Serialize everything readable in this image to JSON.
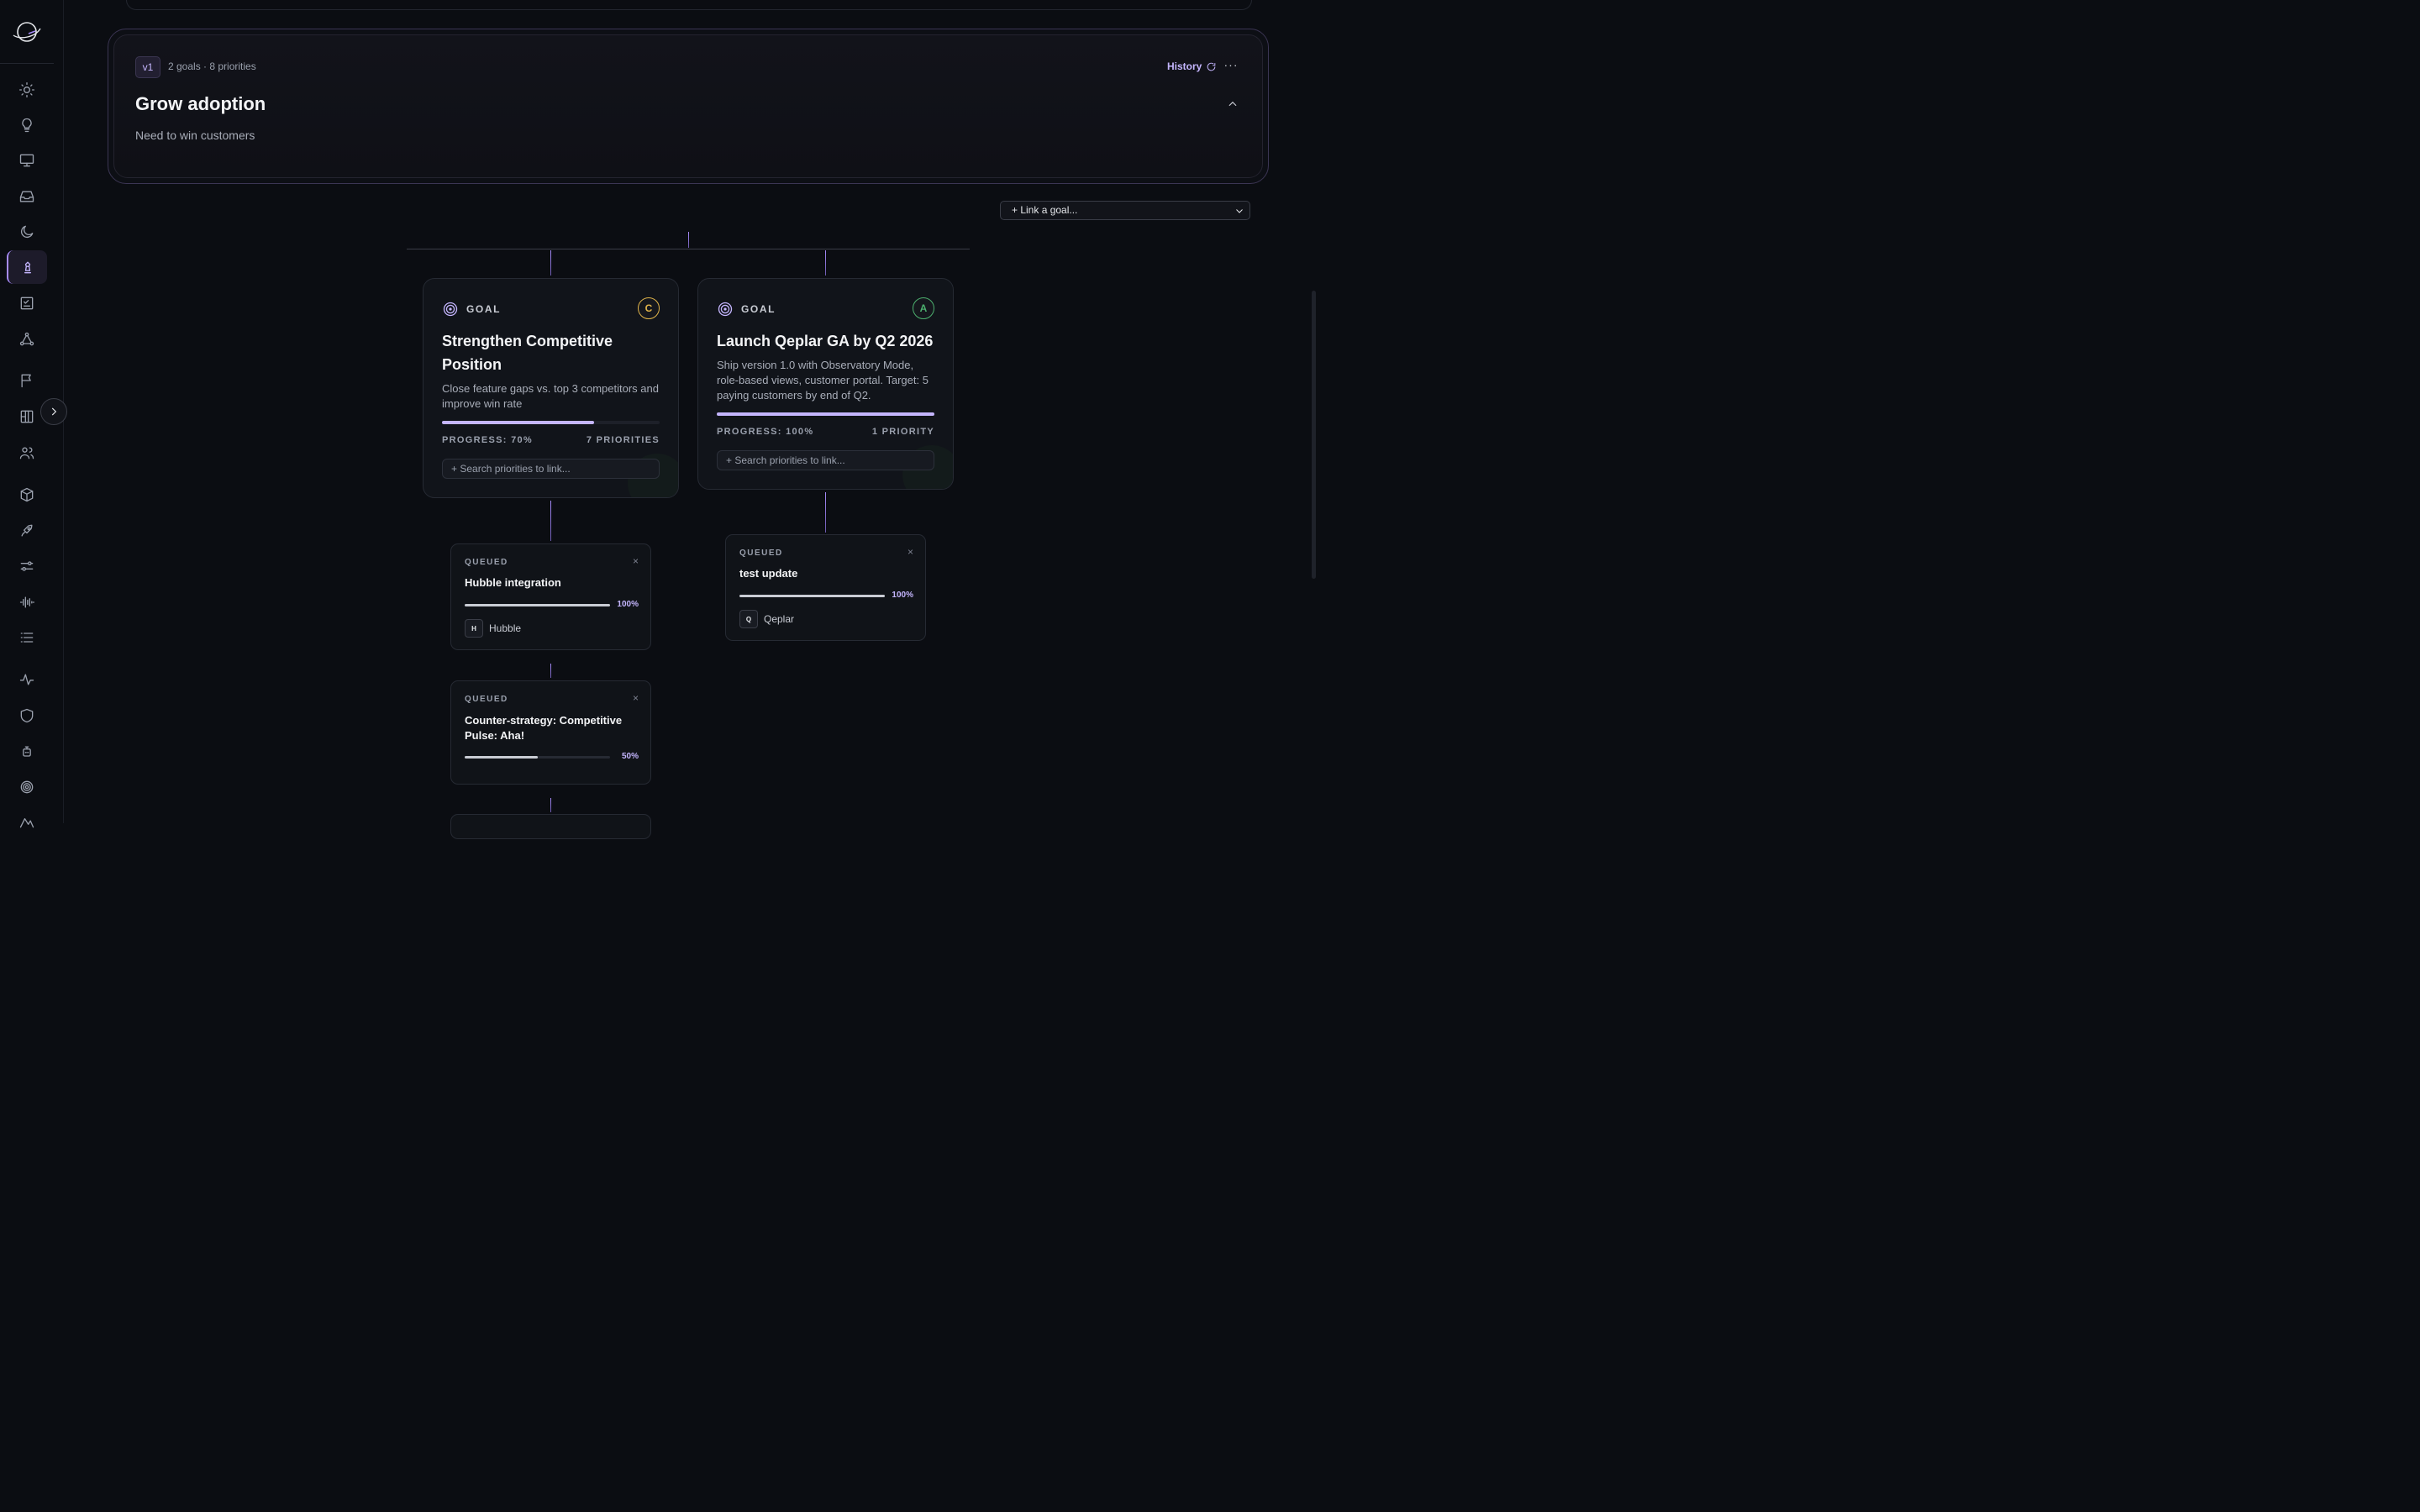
{
  "objective": {
    "version": "v1",
    "meta": "2 goals · 8 priorities",
    "title": "Grow adoption",
    "description": "Need to win customers",
    "history_label": "History",
    "more_label": "···"
  },
  "link_goal": {
    "label": "+ Link a goal..."
  },
  "goals": [
    {
      "label": "GOAL",
      "grade": "C",
      "grade_color": "#e0b44a",
      "title": "Strengthen Competitive Position",
      "description": "Close feature gaps vs. top 3 competitors and improve win rate",
      "progress": 0.7,
      "progress_label": "PROGRESS: 70%",
      "priorities_label": "7 PRIORITIES",
      "search_placeholder": "+ Search priorities to link..."
    },
    {
      "label": "GOAL",
      "grade": "A",
      "grade_color": "#4caf6e",
      "title": "Launch Qeplar GA by Q2 2026",
      "description": "Ship version 1.0 with Observatory Mode, role-based views, customer portal. Target: 5 paying customers by end of Q2.",
      "progress": 1.0,
      "progress_label": "PROGRESS: 100%",
      "priorities_label": "1 PRIORITY",
      "search_placeholder": "+ Search priorities to link..."
    }
  ],
  "priorities": [
    {
      "status": "QUEUED",
      "close": "×",
      "title": "Hubble integration",
      "progress": 1.0,
      "pct": "100%",
      "owner_initial": "H",
      "owner": "Hubble"
    },
    {
      "status": "QUEUED",
      "close": "×",
      "title": "Counter-strategy: Competitive Pulse: Aha!",
      "progress": 0.5,
      "pct": "50%"
    },
    {
      "status": "QUEUED",
      "close": "×",
      "title": "test update",
      "progress": 1.0,
      "pct": "100%",
      "owner_initial": "Q",
      "owner": "Qeplar"
    }
  ],
  "sidebar": {
    "icons": [
      "sun-icon",
      "lightbulb-icon",
      "monitor-icon",
      "inbox-icon",
      "moon-icon",
      "chess-icon",
      "checklist-icon",
      "network-icon",
      "flag-icon",
      "grid-icon",
      "users-icon",
      "cube-icon",
      "rocket-icon",
      "sliders-icon",
      "waveform-icon",
      "list-icon",
      "activity-icon",
      "shield-icon",
      "robot-icon",
      "target-icon"
    ],
    "active": "chess-icon"
  },
  "colors": {
    "accent": "#c4b5fd",
    "background": "#0b0d12"
  }
}
